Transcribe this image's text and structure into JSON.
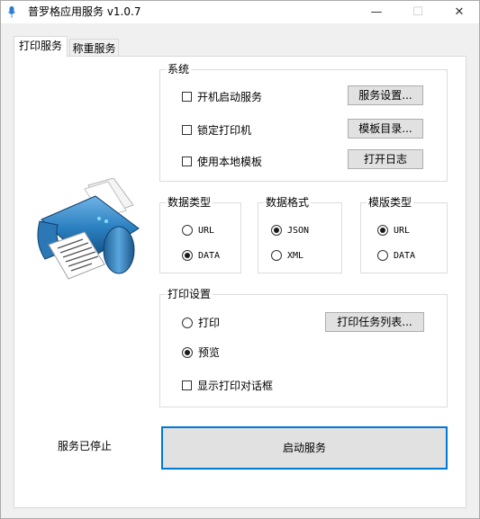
{
  "window": {
    "title": "普罗格应用服务 v1.0.7",
    "controls": {
      "minimize": "—",
      "maximize": "☐",
      "close": "✕"
    }
  },
  "tabs": [
    {
      "label": "打印服务",
      "active": true
    },
    {
      "label": "称重服务",
      "active": false
    }
  ],
  "system": {
    "title": "系统",
    "checkboxes": [
      {
        "label": "开机启动服务",
        "checked": false
      },
      {
        "label": "锁定打印机",
        "checked": false
      },
      {
        "label": "使用本地模板",
        "checked": false
      }
    ],
    "buttons": [
      "服务设置...",
      "模板目录...",
      "打开日志"
    ]
  },
  "data_type": {
    "title": "数据类型",
    "options": [
      {
        "label": "URL",
        "selected": false
      },
      {
        "label": "DATA",
        "selected": true
      }
    ]
  },
  "data_format": {
    "title": "数据格式",
    "options": [
      {
        "label": "JSON",
        "selected": true
      },
      {
        "label": "XML",
        "selected": false
      }
    ]
  },
  "template_type": {
    "title": "模版类型",
    "options": [
      {
        "label": "URL",
        "selected": true
      },
      {
        "label": "DATA",
        "selected": false
      }
    ]
  },
  "print_settings": {
    "title": "打印设置",
    "radios": [
      {
        "label": "打印",
        "selected": false
      },
      {
        "label": "预览",
        "selected": true
      }
    ],
    "task_list_button": "打印任务列表...",
    "dialog_checkbox": {
      "label": "显示打印对话框",
      "checked": false
    }
  },
  "status_text": "服务已停止",
  "start_button": "启动服务",
  "icons": {
    "app": "microphone-icon",
    "illustration": "printer-icon"
  },
  "colors": {
    "focus_border": "#0078d7",
    "printer_blue": "#2a7fc0"
  }
}
